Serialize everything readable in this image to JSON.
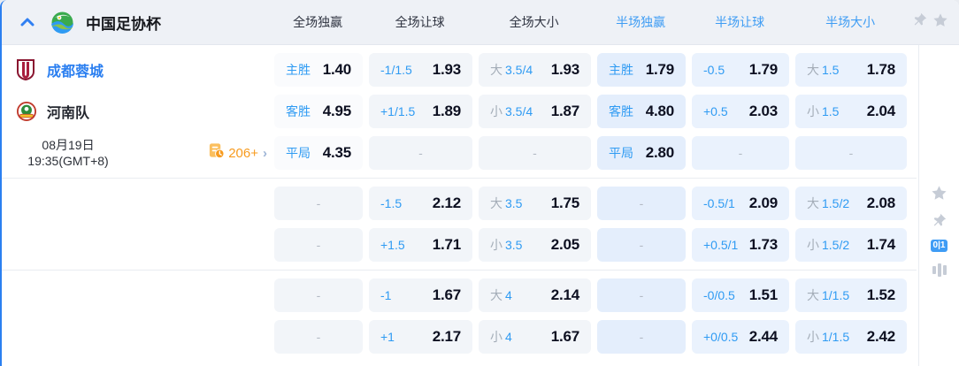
{
  "header": {
    "league": "中国足协杯",
    "columns": [
      {
        "label": "全场独赢",
        "half": false
      },
      {
        "label": "全场让球",
        "half": false
      },
      {
        "label": "全场大小",
        "half": false
      },
      {
        "label": "半场独赢",
        "half": true
      },
      {
        "label": "半场让球",
        "half": true
      },
      {
        "label": "半场大小",
        "half": true
      }
    ]
  },
  "match": {
    "home_team": "成都蓉城",
    "away_team": "河南队",
    "date": "08月19日",
    "time": "19:35(GMT+8)",
    "markets_count": "206+"
  },
  "colors": {
    "accent_blue": "#2f9bf3",
    "half_column_blue": "#3d9cf4",
    "cell_full_bg": "#f2f5f9",
    "cell_half_bg": "#eaf2fd",
    "orange": "#f79b1f",
    "value_dark": "#0d1021"
  },
  "sidebar": {
    "corner_score_badge": "0|1"
  },
  "odds_groups": [
    {
      "rows": [
        {
          "cells": [
            {
              "label": "主胜",
              "value": "1.40"
            },
            {
              "label": "-1/1.5",
              "value": "1.93"
            },
            {
              "prefix": "大",
              "label": "3.5/4",
              "value": "1.93"
            },
            {
              "label": "主胜",
              "value": "1.79"
            },
            {
              "label": "-0.5",
              "value": "1.79"
            },
            {
              "prefix": "大",
              "label": "1.5",
              "value": "1.78"
            }
          ]
        },
        {
          "cells": [
            {
              "label": "客胜",
              "value": "4.95"
            },
            {
              "label": "+1/1.5",
              "value": "1.89"
            },
            {
              "prefix": "小",
              "label": "3.5/4",
              "value": "1.87"
            },
            {
              "label": "客胜",
              "value": "4.80"
            },
            {
              "label": "+0.5",
              "value": "2.03"
            },
            {
              "prefix": "小",
              "label": "1.5",
              "value": "2.04"
            }
          ]
        },
        {
          "cells": [
            {
              "label": "平局",
              "value": "4.35"
            },
            {
              "dash": "-"
            },
            {
              "dash": "-"
            },
            {
              "label": "平局",
              "value": "2.80"
            },
            {
              "dash": "-"
            },
            {
              "dash": "-"
            }
          ]
        }
      ]
    },
    {
      "rows": [
        {
          "cells": [
            {
              "dash": "-"
            },
            {
              "label": "-1.5",
              "value": "2.12"
            },
            {
              "prefix": "大",
              "label": "3.5",
              "value": "1.75"
            },
            {
              "dash": "-"
            },
            {
              "label": "-0.5/1",
              "value": "2.09"
            },
            {
              "prefix": "大",
              "label": "1.5/2",
              "value": "2.08"
            }
          ]
        },
        {
          "cells": [
            {
              "dash": "-"
            },
            {
              "label": "+1.5",
              "value": "1.71"
            },
            {
              "prefix": "小",
              "label": "3.5",
              "value": "2.05"
            },
            {
              "dash": "-"
            },
            {
              "label": "+0.5/1",
              "value": "1.73"
            },
            {
              "prefix": "小",
              "label": "1.5/2",
              "value": "1.74"
            }
          ]
        }
      ]
    },
    {
      "rows": [
        {
          "cells": [
            {
              "dash": "-"
            },
            {
              "label": "-1",
              "value": "1.67"
            },
            {
              "prefix": "大",
              "label": "4",
              "value": "2.14"
            },
            {
              "dash": "-"
            },
            {
              "label": "-0/0.5",
              "value": "1.51"
            },
            {
              "prefix": "大",
              "label": "1/1.5",
              "value": "1.52"
            }
          ]
        },
        {
          "cells": [
            {
              "dash": "-"
            },
            {
              "label": "+1",
              "value": "2.17"
            },
            {
              "prefix": "小",
              "label": "4",
              "value": "1.67"
            },
            {
              "dash": "-"
            },
            {
              "label": "+0/0.5",
              "value": "2.44"
            },
            {
              "prefix": "小",
              "label": "1/1.5",
              "value": "2.42"
            }
          ]
        }
      ]
    }
  ]
}
